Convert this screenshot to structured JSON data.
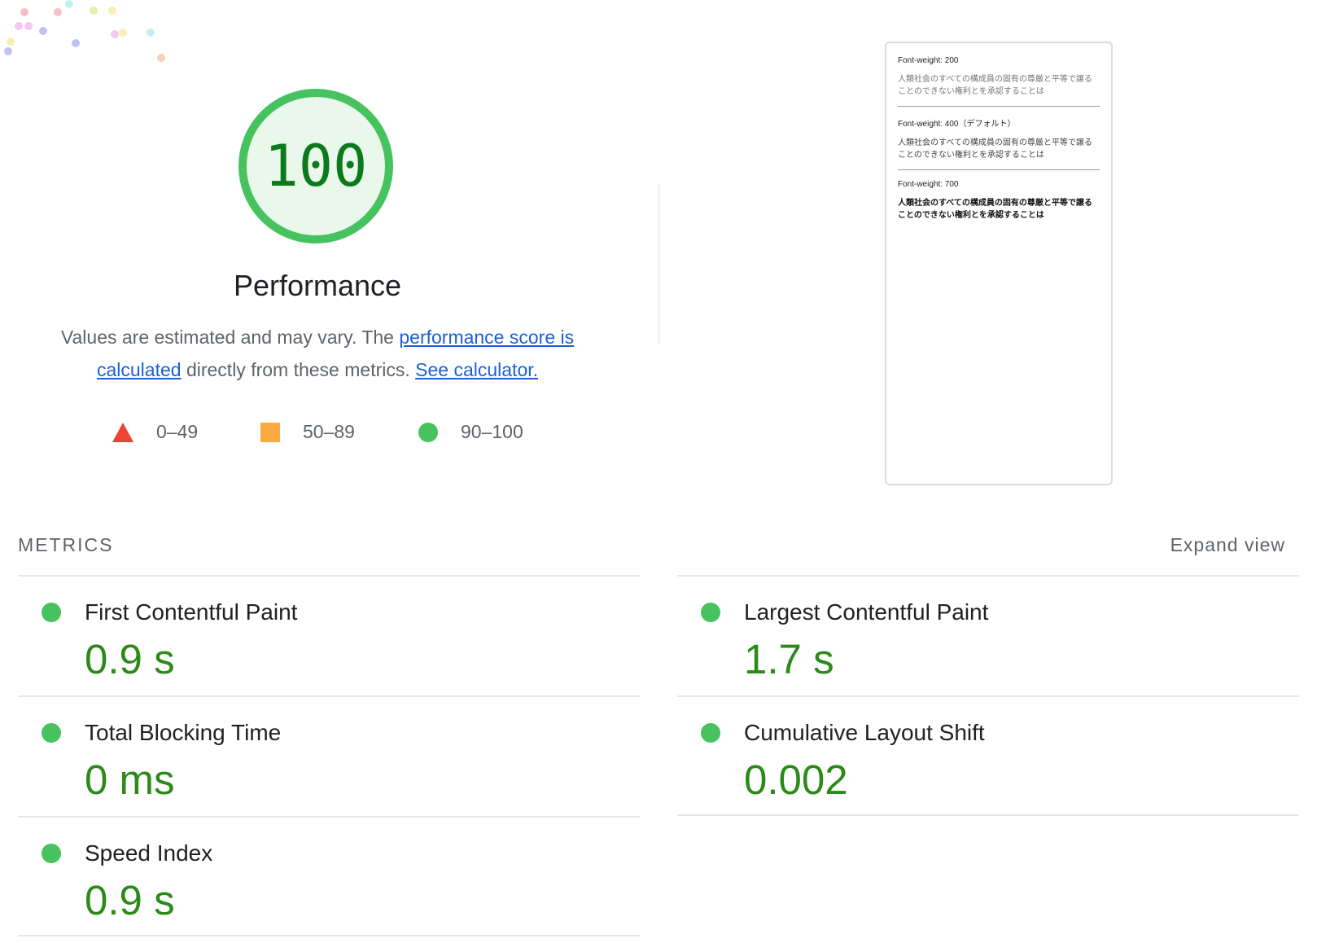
{
  "gauge": {
    "score": "100",
    "title": "Performance",
    "color": "#46c35f",
    "fill": "#eaf8ec",
    "score_color": "#0b7a1b"
  },
  "description": {
    "text_before": "Values are estimated and may vary. The ",
    "link1": "performance score is calculated",
    "text_middle": " directly from these metrics. ",
    "link2": "See calculator."
  },
  "legend": [
    {
      "shape": "triangle",
      "range": "0–49",
      "color": "#eb4335"
    },
    {
      "shape": "square",
      "range": "50–89",
      "color": "#f9ab3d"
    },
    {
      "shape": "circle",
      "range": "90–100",
      "color": "#46c35f"
    }
  ],
  "thumbnail": {
    "blocks": [
      {
        "heading": "Font-weight: 200",
        "body": "人類社会のすべての構成員の固有の尊厳と平等で譲ることのできない権利とを承認することは"
      },
      {
        "heading": "Font-weight: 400（デフォルト）",
        "body": "人類社会のすべての構成員の固有の尊厳と平等で譲ることのできない権利とを承認することは"
      },
      {
        "heading": "Font-weight: 700",
        "body": "人類社会のすべての構成員の固有の尊厳と平等で譲ることのできない権利とを承認することは"
      }
    ]
  },
  "metrics_header": "METRICS",
  "expand_view": "Expand view",
  "metrics_left": [
    {
      "name": "First Contentful Paint",
      "value": "0.9 s"
    },
    {
      "name": "Total Blocking Time",
      "value": "0 ms"
    },
    {
      "name": "Speed Index",
      "value": "0.9 s"
    }
  ],
  "metrics_right": [
    {
      "name": "Largest Contentful Paint",
      "value": "1.7 s"
    },
    {
      "name": "Cumulative Layout Shift",
      "value": "0.002"
    }
  ],
  "pass_color": "#46c35f",
  "value_color": "#2b8a18"
}
